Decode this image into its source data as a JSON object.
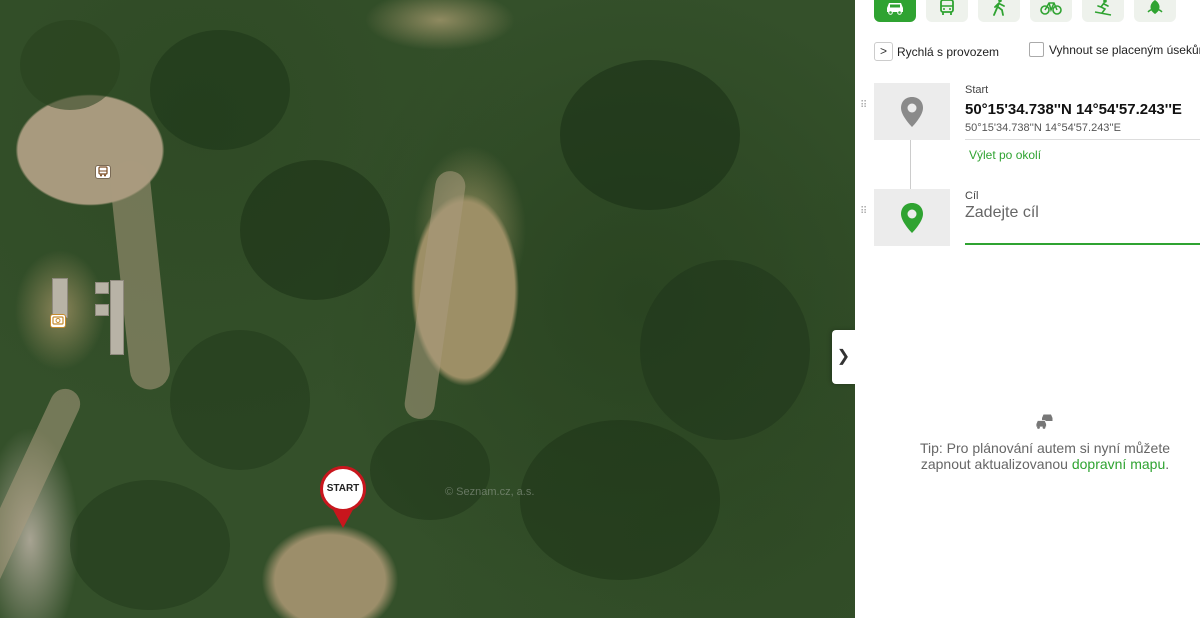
{
  "map": {
    "start_marker_label": "START",
    "watermark": "© Seznam.cz, a.s.",
    "poi_icons": [
      "bus-stop-icon",
      "camera-icon"
    ]
  },
  "panel_toggle": {
    "glyph": "❯"
  },
  "transport_modes": [
    {
      "name": "car",
      "icon": "car-icon",
      "active": true
    },
    {
      "name": "public-transport",
      "icon": "bus-icon",
      "active": false
    },
    {
      "name": "walking",
      "icon": "walking-icon",
      "active": false
    },
    {
      "name": "cycling",
      "icon": "bicycle-icon",
      "active": false
    },
    {
      "name": "skiing",
      "icon": "ski-icon",
      "active": false
    },
    {
      "name": "trip",
      "icon": "leaf-icon",
      "active": false
    }
  ],
  "route_options": {
    "chevron": ">",
    "route_type": "Rychlá s provozem",
    "avoid_tolls": "Vyhnout se placeným úsekům",
    "avoid_tolls_checked": false
  },
  "start": {
    "label": "Start",
    "value": "50°15'34.738''N 14°54'57.243''E",
    "sub": "50°15'34.738''N 14°54'57.243''E",
    "link": "Výlet po okolí"
  },
  "goal": {
    "label": "Cíl",
    "placeholder": "Zadejte cíl"
  },
  "tip": {
    "text": "Tip: Pro plánování autem si nyní můžete zapnout aktualizovanou",
    "link": "dopravní mapu",
    "suffix": "."
  },
  "colors": {
    "accent": "#2fa331",
    "start_marker": "#c8161d",
    "pin_grey": "#8a8a8a"
  }
}
